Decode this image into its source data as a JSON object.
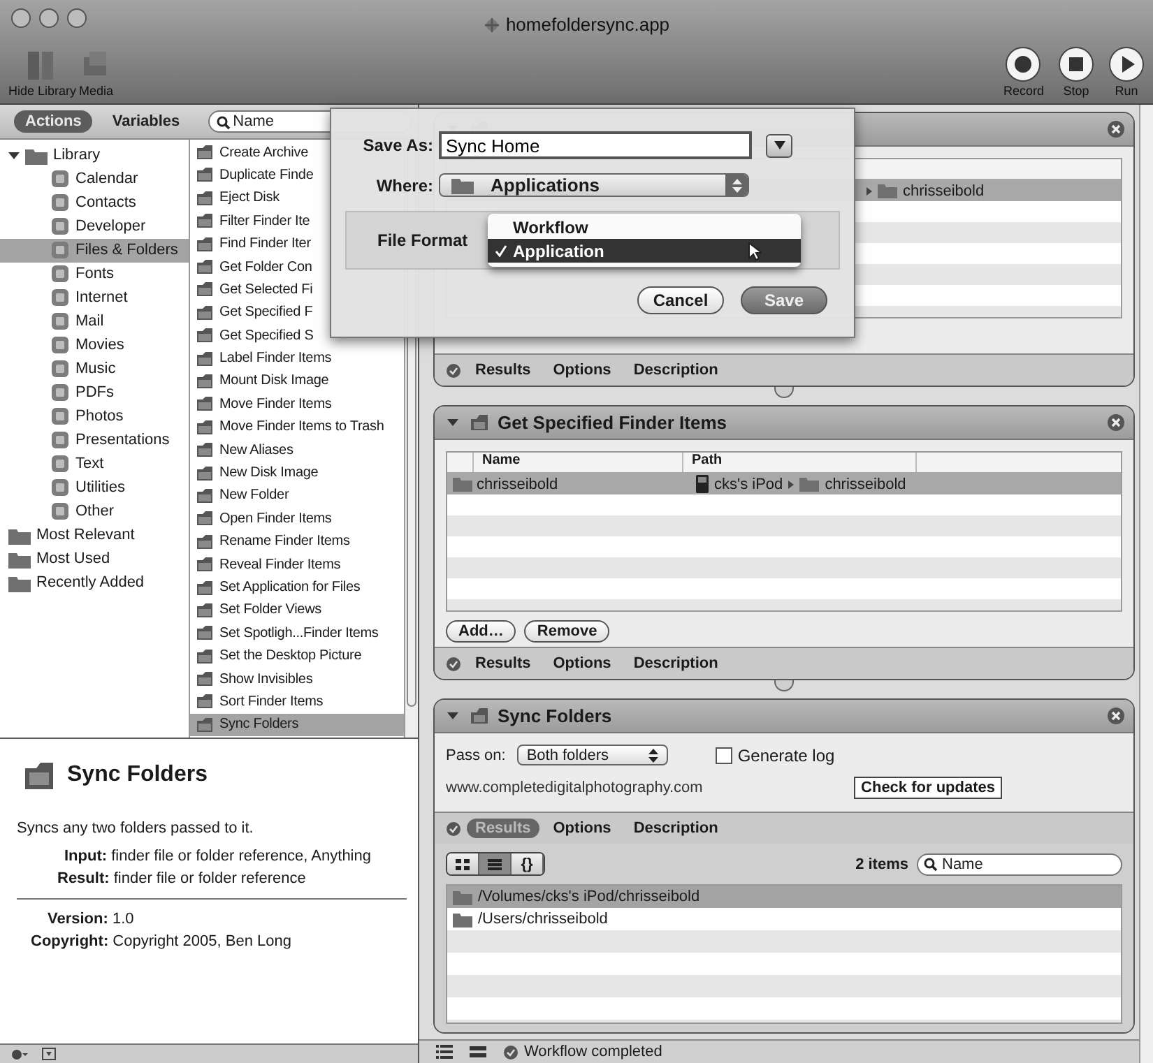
{
  "window": {
    "title": "homefoldersync.app"
  },
  "toolbar": {
    "left": [
      {
        "kind": "library",
        "label": "Hide Library"
      },
      {
        "kind": "media",
        "label": "Media"
      }
    ],
    "right": [
      {
        "kind": "record",
        "label": "Record"
      },
      {
        "kind": "stop",
        "label": "Stop"
      },
      {
        "kind": "run",
        "label": "Run"
      }
    ]
  },
  "library_tabs": [
    {
      "label": "Actions",
      "selected": true
    },
    {
      "label": "Variables",
      "selected": false
    }
  ],
  "search": {
    "placeholder": "Name"
  },
  "library_tree": [
    {
      "label": "Library",
      "selected": false,
      "expanded": true,
      "children": [
        {
          "label": "Calendar",
          "selected": false
        },
        {
          "label": "Contacts",
          "selected": false
        },
        {
          "label": "Developer",
          "selected": false
        },
        {
          "label": "Files & Folders",
          "selected": true
        },
        {
          "label": "Fonts",
          "selected": false
        },
        {
          "label": "Internet",
          "selected": false
        },
        {
          "label": "Mail",
          "selected": false
        },
        {
          "label": "Movies",
          "selected": false
        },
        {
          "label": "Music",
          "selected": false
        },
        {
          "label": "PDFs",
          "selected": false
        },
        {
          "label": "Photos",
          "selected": false
        },
        {
          "label": "Presentations",
          "selected": false
        },
        {
          "label": "Text",
          "selected": false
        },
        {
          "label": "Utilities",
          "selected": false
        },
        {
          "label": "Other",
          "selected": false
        }
      ]
    },
    {
      "label": "Most Relevant",
      "selected": false
    },
    {
      "label": "Most Used",
      "selected": false
    },
    {
      "label": "Recently Added",
      "selected": false
    }
  ],
  "actions": [
    {
      "label": "Create Archive",
      "selected": false
    },
    {
      "label": "Duplicate Finde",
      "selected": false
    },
    {
      "label": "Eject Disk",
      "selected": false
    },
    {
      "label": "Filter Finder Ite",
      "selected": false
    },
    {
      "label": "Find Finder Iter",
      "selected": false
    },
    {
      "label": "Get Folder Con",
      "selected": false
    },
    {
      "label": "Get Selected Fi",
      "selected": false
    },
    {
      "label": "Get Specified F",
      "selected": false
    },
    {
      "label": "Get Specified S",
      "selected": false
    },
    {
      "label": "Label Finder Items",
      "selected": false
    },
    {
      "label": "Mount Disk Image",
      "selected": false
    },
    {
      "label": "Move Finder Items",
      "selected": false
    },
    {
      "label": "Move Finder Items to Trash",
      "selected": false
    },
    {
      "label": "New Aliases",
      "selected": false
    },
    {
      "label": "New Disk Image",
      "selected": false
    },
    {
      "label": "New Folder",
      "selected": false
    },
    {
      "label": "Open Finder Items",
      "selected": false
    },
    {
      "label": "Rename Finder Items",
      "selected": false
    },
    {
      "label": "Reveal Finder Items",
      "selected": false
    },
    {
      "label": "Set Application for Files",
      "selected": false
    },
    {
      "label": "Set Folder Views",
      "selected": false
    },
    {
      "label": "Set Spotligh...Finder Items",
      "selected": false
    },
    {
      "label": "Set the Desktop Picture",
      "selected": false
    },
    {
      "label": "Show Invisibles",
      "selected": false
    },
    {
      "label": "Sort Finder Items",
      "selected": false
    },
    {
      "label": "Sync Folders",
      "selected": true
    }
  ],
  "description": {
    "title": "Sync Folders",
    "summary": "Syncs any two folders passed to it.",
    "input": "**Input:** finder file or folder reference, Anything",
    "result": "**Result:** finder file or folder reference",
    "version": "**Version:** 1.0",
    "copyright": "**Copyright:** Copyright 2005, Ben Long"
  },
  "workflow": [
    {
      "kind": "files",
      "expanded": true,
      "rows": [
        {
          "name": "",
          "path": [
            "chrisseibold"
          ],
          "selected": true
        }
      ],
      "footer_tabs": [
        {
          "label": "Results",
          "selected": false
        },
        {
          "label": "Options",
          "selected": false
        },
        {
          "label": "Description",
          "selected": false
        }
      ]
    },
    {
      "kind": "files",
      "title": "Get Specified Finder Items",
      "expanded": true,
      "columns": [
        "Name",
        "Path"
      ],
      "rows": [
        {
          "name": "chrisseibold",
          "path": [
            "cks's iPod",
            "chrisseibold"
          ],
          "selected": true
        }
      ],
      "buttons": [
        "Add…",
        "Remove"
      ],
      "footer_tabs": [
        {
          "label": "Results",
          "selected": false
        },
        {
          "label": "Options",
          "selected": false
        },
        {
          "label": "Description",
          "selected": false
        }
      ]
    },
    {
      "kind": "sync",
      "title": "Sync Folders",
      "expanded": true,
      "pass_on_label": "Pass on:",
      "pass_on": "Both folders",
      "generate_log": {
        "label": "Generate log",
        "checked": false
      },
      "link": "www.completedigitalphotography.com",
      "update_button": "Check for updates",
      "footer_tabs": [
        {
          "label": "Results",
          "selected": true
        },
        {
          "label": "Options",
          "selected": false
        },
        {
          "label": "Description",
          "selected": false
        }
      ],
      "view_buttons": [
        {
          "kind": "icons",
          "selected": false
        },
        {
          "kind": "list",
          "selected": true
        },
        {
          "kind": "text",
          "label": "{}",
          "selected": false
        }
      ],
      "count": "2 items",
      "search_placeholder": "Name",
      "results": [
        {
          "label": "/Volumes/cks's iPod/chrisseibold",
          "selected": true
        },
        {
          "label": "/Users/chrisseibold",
          "selected": false
        }
      ]
    }
  ],
  "dialog": {
    "save_as_label": "Save As:",
    "save_as": "Sync Home",
    "where_label": "Where:",
    "where": "Applications",
    "format_label": "File Format",
    "format_options": [
      {
        "label": "Workflow",
        "selected": false
      },
      {
        "label": "Application",
        "selected": true
      }
    ],
    "buttons": [
      {
        "label": "Cancel",
        "default": false
      },
      {
        "label": "Save",
        "default": true
      }
    ]
  },
  "status": "Workflow completed"
}
